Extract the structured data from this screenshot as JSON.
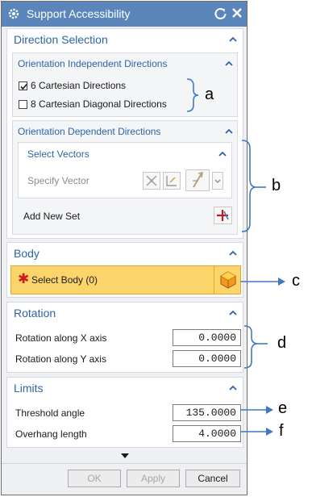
{
  "dialog": {
    "title": "Support Accessibility"
  },
  "direction_selection": {
    "title": "Direction Selection",
    "orientation_independent": {
      "title": "Orientation Independent Directions",
      "options": [
        {
          "label": "6 Cartesian Directions",
          "checked": true
        },
        {
          "label": "8 Cartesian Diagonal Directions",
          "checked": false
        }
      ]
    },
    "orientation_dependent": {
      "title": "Orientation Dependent Directions",
      "select_vectors": {
        "title": "Select Vectors",
        "specify_label": "Specify Vector"
      },
      "add_new_set_label": "Add New Set"
    }
  },
  "body_section": {
    "title": "Body",
    "select_label": "Select Body (0)"
  },
  "rotation": {
    "title": "Rotation",
    "x_label": "Rotation along X axis",
    "x_value": "0.0000",
    "y_label": "Rotation along Y axis",
    "y_value": "0.0000"
  },
  "limits": {
    "title": "Limits",
    "threshold_label": "Threshold angle",
    "threshold_value": "135.0000",
    "overhang_label": "Overhang length",
    "overhang_value": "4.0000"
  },
  "buttons": {
    "ok": "OK",
    "apply": "Apply",
    "cancel": "Cancel"
  },
  "annotations": {
    "a": "a",
    "b": "b",
    "c": "c",
    "d": "d",
    "e": "e",
    "f": "f"
  },
  "colors": {
    "title_bar": "#5a86bb",
    "heading": "#2e64a7",
    "highlight": "#fbd56a",
    "required": "#d11a1a",
    "arrow": "#3e79c6"
  }
}
